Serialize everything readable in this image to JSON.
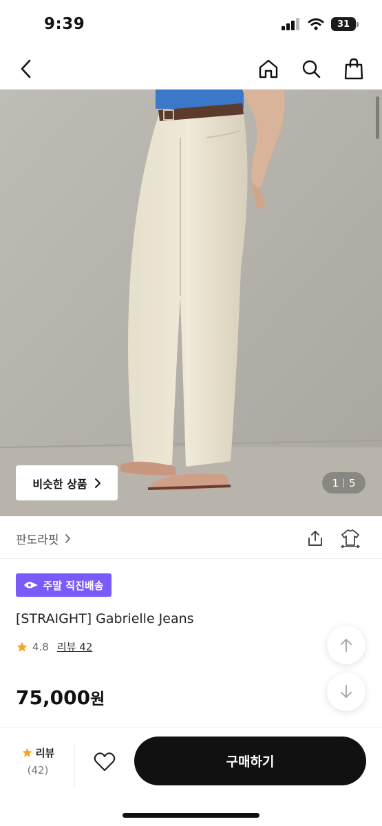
{
  "status_bar": {
    "time": "9:39",
    "battery": "31"
  },
  "nav": {
    "back_icon": "chevron-left-icon",
    "home_icon": "home-icon",
    "search_icon": "search-icon",
    "bag_icon": "shopping-bag-icon"
  },
  "hero": {
    "similar_label": "비슷한 상품",
    "page_current": "1",
    "page_total": "5"
  },
  "brand": {
    "name": "판도라핏"
  },
  "product": {
    "badge": "주말 직진배송",
    "title": "[STRAIGHT] Gabrielle Jeans",
    "rating": "4.8",
    "review_link": "리뷰 42",
    "price": "75,000",
    "price_unit": "원"
  },
  "bottom": {
    "review_label": "리뷰",
    "review_count": "(42)",
    "buy_label": "구매하기"
  },
  "colors": {
    "badge": "#7a5af8",
    "star": "#f5a623",
    "buy_button": "#111111"
  }
}
